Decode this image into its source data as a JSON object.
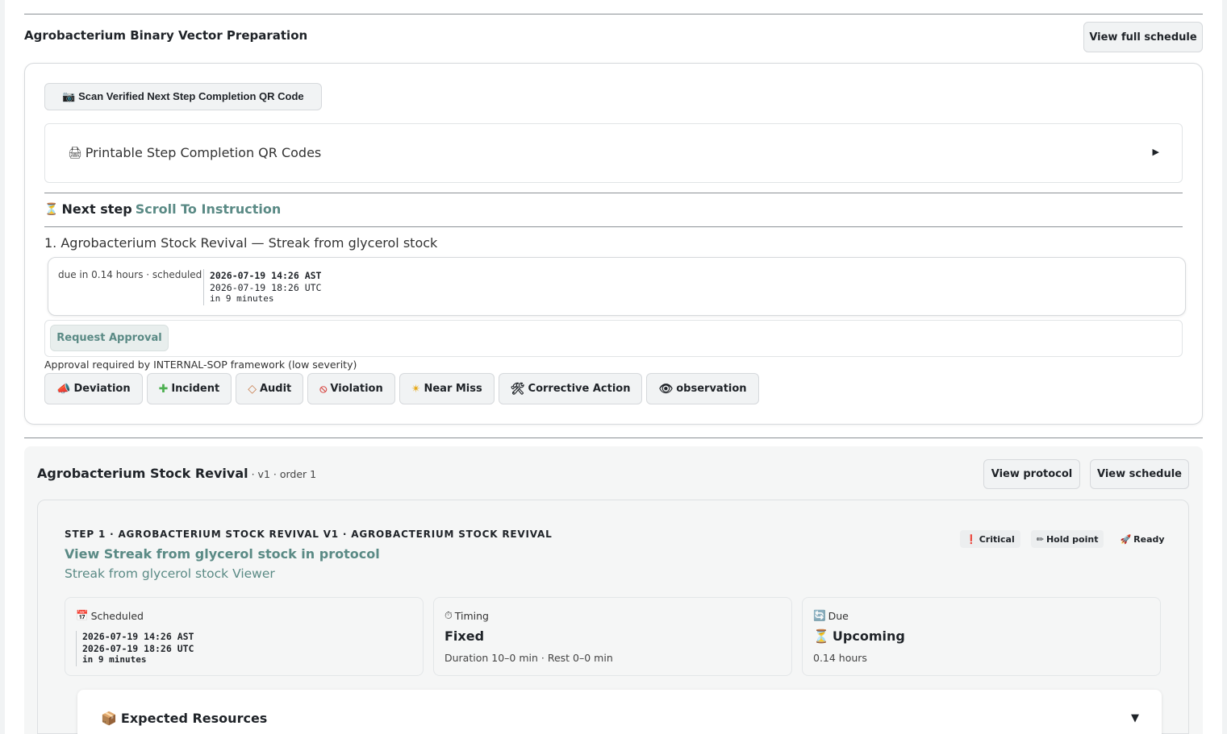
{
  "header": {
    "title": "Agrobacterium Binary Vector Preparation",
    "view_full_schedule": "View full schedule"
  },
  "scan": {
    "icon": "camera-icon",
    "label": "📷 Scan Verified Next Step Completion QR Code"
  },
  "printable": {
    "icon": "printer-icon",
    "label": "Printable Step Completion QR Codes",
    "arrow": "▶"
  },
  "next_step": {
    "icon": "hourglass-icon",
    "label": "Next step",
    "link": "Scroll To Instruction"
  },
  "step_line": "1. Agrobacterium Stock Revival — Streak from glycerol stock",
  "due": {
    "label": "due in 0.14 hours · scheduled",
    "local": "2026-07-19 14:26 AST",
    "utc": "2026-07-19 18:26 UTC",
    "relative": "in 9 minutes"
  },
  "approval": {
    "button": "Request Approval",
    "note": "Approval required by INTERNAL-SOP framework (low severity)"
  },
  "chips": [
    {
      "icon": "megaphone-icon",
      "label": "Deviation"
    },
    {
      "icon": "cross-icon",
      "label": "Incident"
    },
    {
      "icon": "diamond-icon",
      "label": "Audit"
    },
    {
      "icon": "no-entry-icon",
      "label": "Violation"
    },
    {
      "icon": "collision-icon",
      "label": "Near Miss"
    },
    {
      "icon": "hammer-wrench-icon",
      "label": "Corrective Action"
    },
    {
      "icon": "eye-icon",
      "label": "observation"
    }
  ],
  "protocol": {
    "title": "Agrobacterium Stock Revival",
    "subtitle": " · v1 · order 1",
    "view_protocol": "View protocol",
    "view_schedule": "View schedule"
  },
  "step": {
    "kicker": "STEP 1 · AGROBACTERIUM STOCK REVIVAL V1 · AGROBACTERIUM STOCK REVIVAL",
    "link": "View Streak from glycerol stock in protocol",
    "viewer": "Streak from glycerol stock Viewer",
    "badges": [
      {
        "icon": "exclamation-icon",
        "label": "Critical"
      },
      {
        "icon": "pen-icon",
        "label": "Hold point"
      },
      {
        "icon": "rocket-icon",
        "label": "Ready"
      }
    ]
  },
  "scheduled": {
    "icon": "calendar-icon",
    "head": "Scheduled",
    "local": "2026-07-19 14:26 AST",
    "utc": "2026-07-19 18:26 UTC",
    "relative": "in 9 minutes"
  },
  "timing": {
    "icon": "stopwatch-icon",
    "head": "Timing",
    "value": "Fixed",
    "detail": "Duration 10–0 min · Rest 0–0 min"
  },
  "due_box": {
    "icon": "arrows-icon",
    "head": "Due",
    "value_icon": "hourglass-icon",
    "value": "Upcoming",
    "detail": "0.14 hours"
  },
  "resources": {
    "icon": "package-icon",
    "label": "Expected Resources",
    "arrow": "▼"
  }
}
